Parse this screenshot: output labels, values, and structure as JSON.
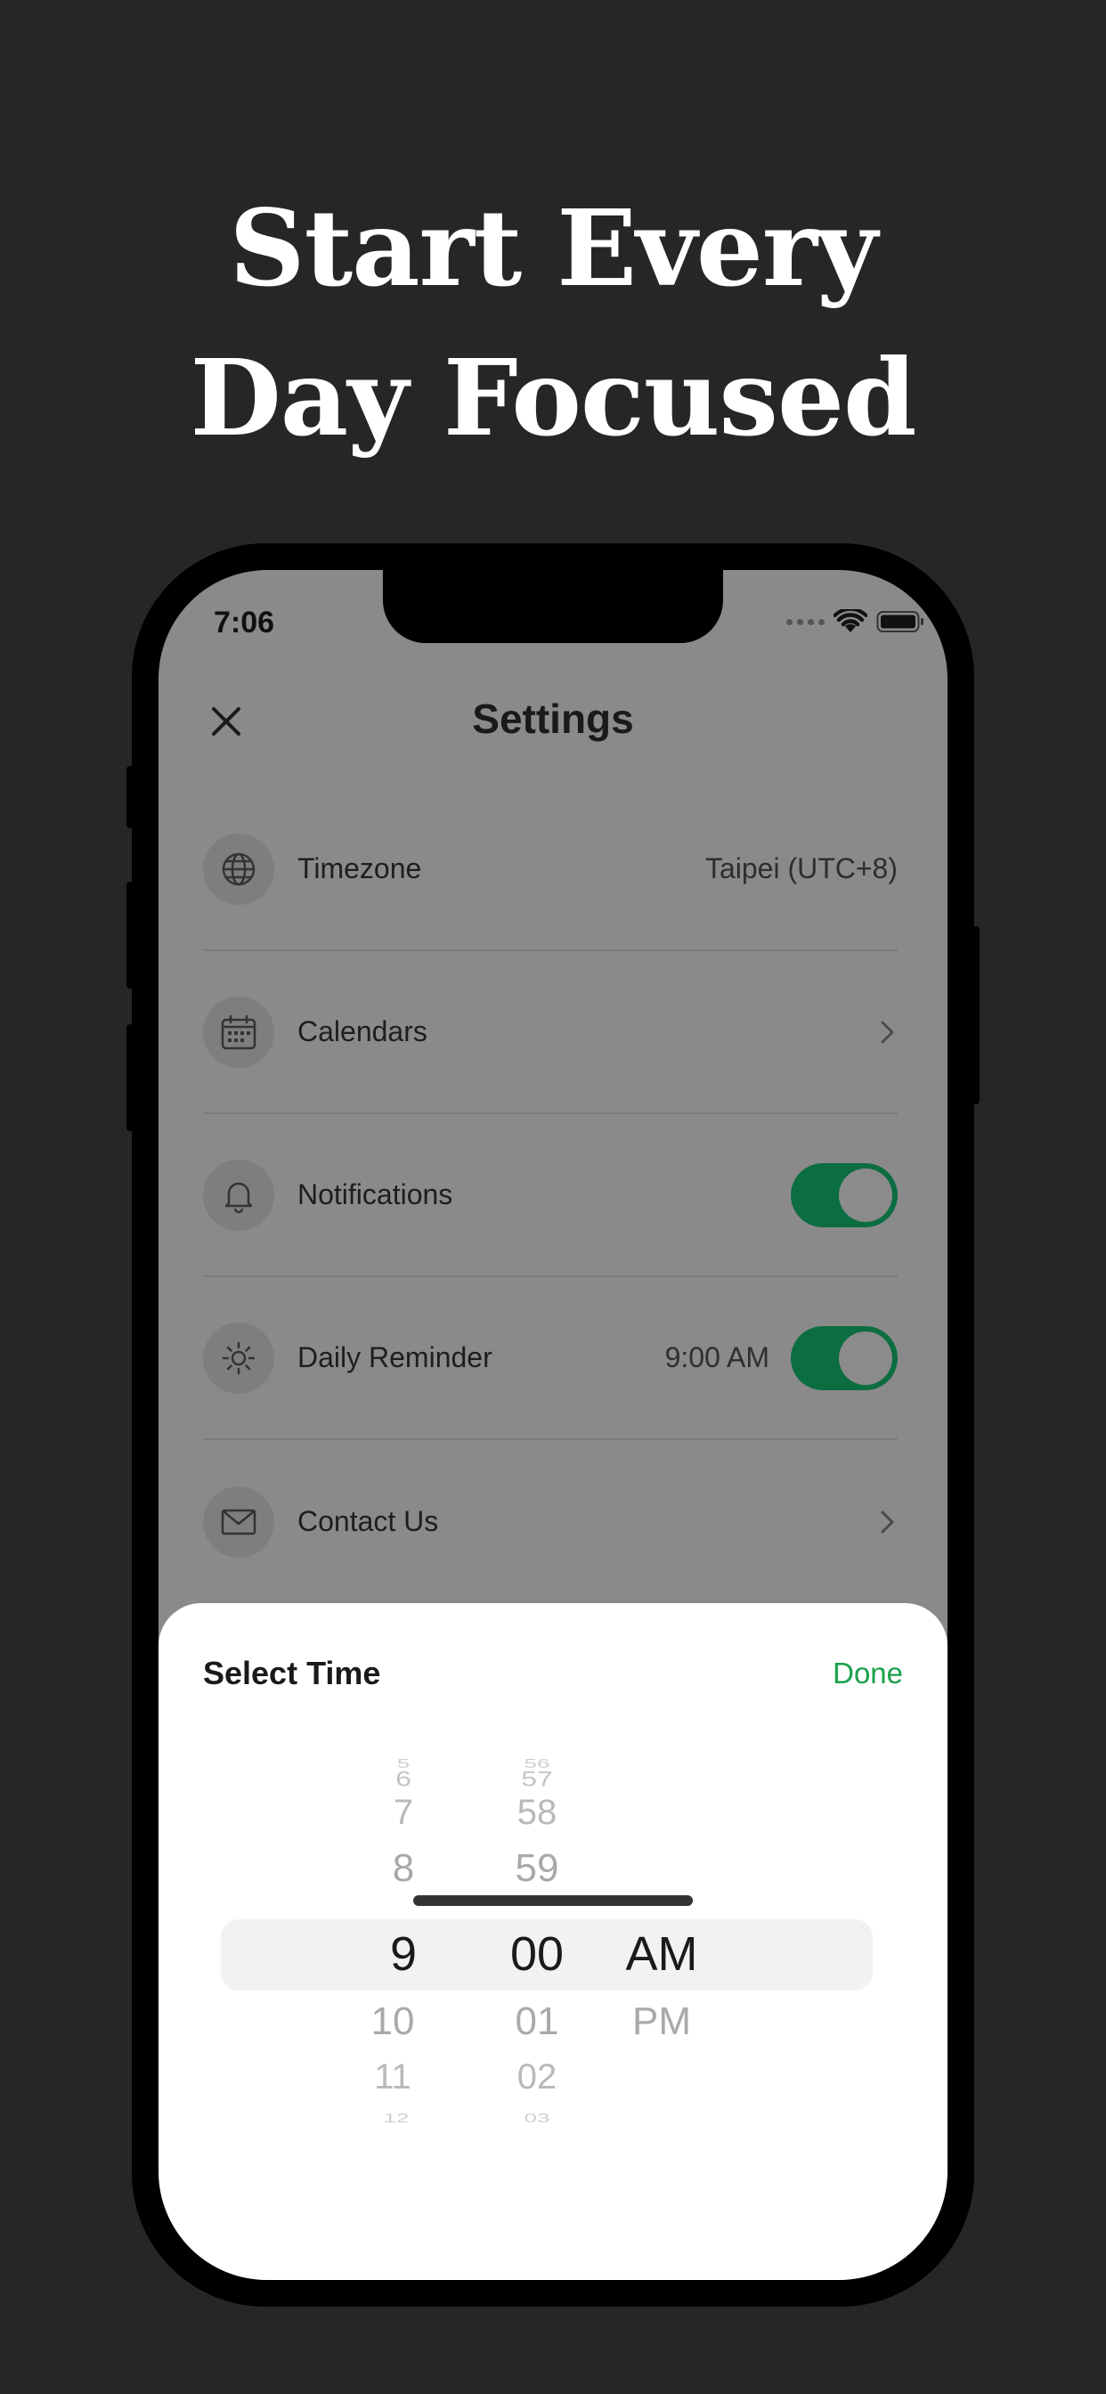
{
  "headline": {
    "line1": "Start Every",
    "line2": "Day Focused"
  },
  "status_bar": {
    "time": "7:06"
  },
  "nav": {
    "title": "Settings",
    "close_icon": "close-icon"
  },
  "settings": {
    "timezone": {
      "label": "Timezone",
      "value": "Taipei (UTC+8)",
      "icon": "globe-icon"
    },
    "calendars": {
      "label": "Calendars",
      "icon": "calendar-icon"
    },
    "notifications": {
      "label": "Notifications",
      "icon": "bell-icon",
      "enabled": true
    },
    "daily_reminder": {
      "label": "Daily Reminder",
      "value": "9:00 AM",
      "icon": "sun-icon",
      "enabled": true
    },
    "contact": {
      "label": "Contact Us",
      "icon": "mail-icon"
    }
  },
  "sheet": {
    "title": "Select Time",
    "done_label": "Done",
    "hours": {
      "far_before": "5",
      "m2": "6",
      "m1_a": "7",
      "m1": "8",
      "selected": "9",
      "p1": "10",
      "p2": "11",
      "far_after": "12"
    },
    "minutes": {
      "far_before": "56",
      "m2": "57",
      "m1_a": "58",
      "m1": "59",
      "selected": "00",
      "p1": "01",
      "p2": "02",
      "far_after": "03"
    },
    "period": {
      "selected": "AM",
      "p1": "PM"
    }
  },
  "colors": {
    "accent": "#1aa04b",
    "toggle_on": "#0c6d40",
    "background": "#262626"
  }
}
